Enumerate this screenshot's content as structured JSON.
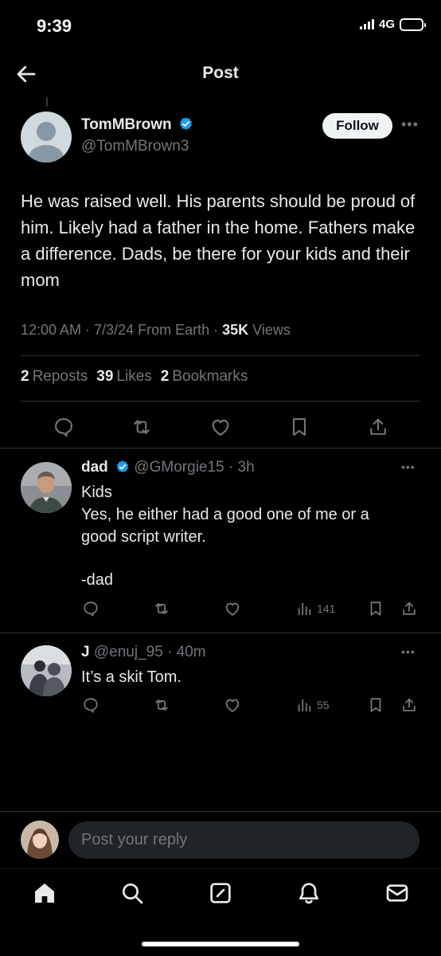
{
  "status_bar": {
    "time": "9:39",
    "network": "4G"
  },
  "header": {
    "title": "Post"
  },
  "post": {
    "author_name": "TomMBrown",
    "author_handle": "@TomMBrown3",
    "follow_label": "Follow",
    "text": "He was raised well. His parents should be proud of him. Likely had a father in the home. Fathers make a difference. Dads, be there for your kids and their mom",
    "meta_time": "12:00 AM · 7/3/24 From Earth · ",
    "views_count": "35K",
    "views_label": " Views",
    "reposts_count": "2",
    "reposts_label": "Reposts",
    "likes_count": "39",
    "likes_label": "Likes",
    "bookmarks_count": "2",
    "bookmarks_label": "Bookmarks"
  },
  "replies": [
    {
      "name": "dad",
      "handle_time": "@GMorgie15 · 3h",
      "lines": [
        "Kids",
        "Yes, he either had a good one of me or a",
        "good script writer.",
        "",
        "-dad"
      ],
      "views": "141"
    },
    {
      "name": "J",
      "handle_time": "@enuj_95 · 40m",
      "lines": [
        "It’s a skit Tom."
      ],
      "views": "55"
    }
  ],
  "composer": {
    "placeholder": "Post your reply"
  },
  "colors": {
    "background": "#000000",
    "muted": "#71767b",
    "verified": "#1d9bf0",
    "text": "#e7e9ea"
  },
  "icons": [
    "back-arrow-icon",
    "verified-badge-icon",
    "more-icon",
    "reply-icon",
    "repost-icon",
    "like-icon",
    "bookmark-icon",
    "share-icon",
    "views-icon",
    "home-icon",
    "search-icon",
    "compose-icon",
    "notifications-icon",
    "messages-icon"
  ]
}
